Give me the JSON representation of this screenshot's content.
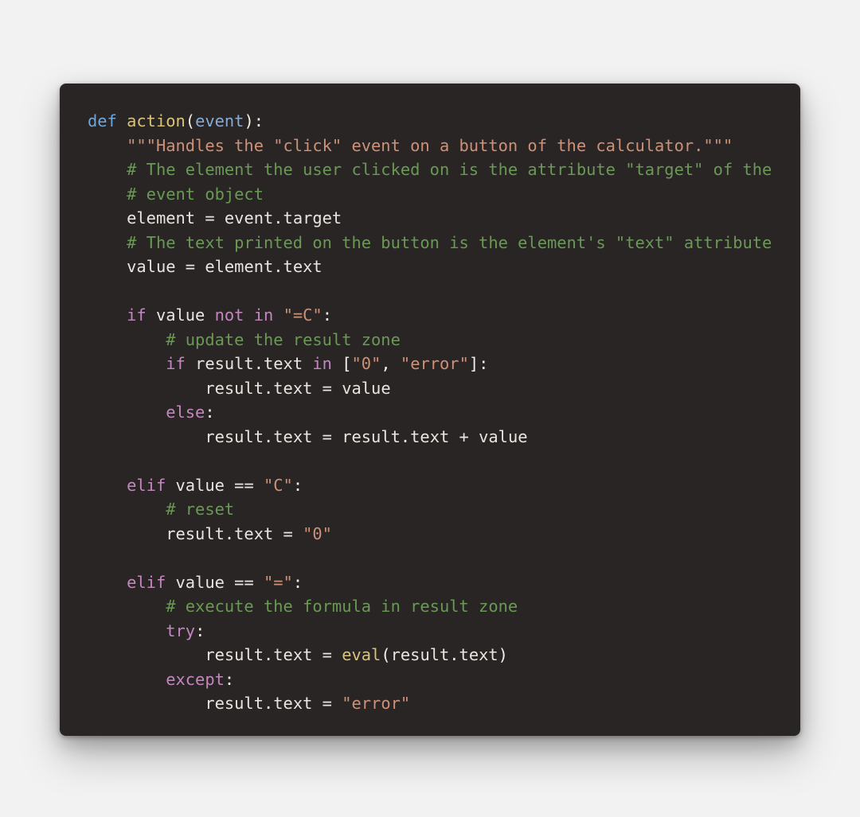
{
  "colors": {
    "page_bg": "#f2f2f2",
    "code_bg": "#282524",
    "default_text": "#e8e4df",
    "keyword_def": "#6fa6da",
    "func_name": "#d9c37a",
    "parameter": "#88aad4",
    "string": "#ce9178",
    "comment": "#699955",
    "control": "#c586c0"
  },
  "code": {
    "language": "python",
    "t": {
      "def": "def",
      "sp": " ",
      "fn_action": "action",
      "lpar": "(",
      "param_event": "event",
      "rpar": ")",
      "colon": ":",
      "indent1": "    ",
      "indent2": "        ",
      "indent3": "            ",
      "doc": "\"\"\"Handles the \"click\" event on a button of the calculator.\"\"\"",
      "c_target1": "# The element the user clicked on is the attribute \"target\" of the",
      "c_target2": "# event object",
      "id_element": "element",
      "eq": " = ",
      "id_event_target": "event.target",
      "c_text_attr": "# The text printed on the button is the element's \"text\" attribute",
      "id_value": "value",
      "id_element_text": "element.text",
      "kw_if": "if",
      "kw_not": "not",
      "kw_in": "in",
      "str_eqC": "\"=C\"",
      "c_update": "# update the result zone",
      "id_result_text": "result.text",
      "lbrk": "[",
      "str_0": "\"0\"",
      "comma": ", ",
      "str_error": "\"error\"",
      "rbrk": "]",
      "kw_else": "else",
      "plus": " + ",
      "kw_elif": "elif",
      "eqeq": " == ",
      "str_C": "\"C\"",
      "c_reset": "# reset",
      "str_eq": "\"=\"",
      "c_execute": "# execute the formula in result zone",
      "kw_try": "try",
      "fn_eval": "eval",
      "kw_except": "except"
    }
  }
}
